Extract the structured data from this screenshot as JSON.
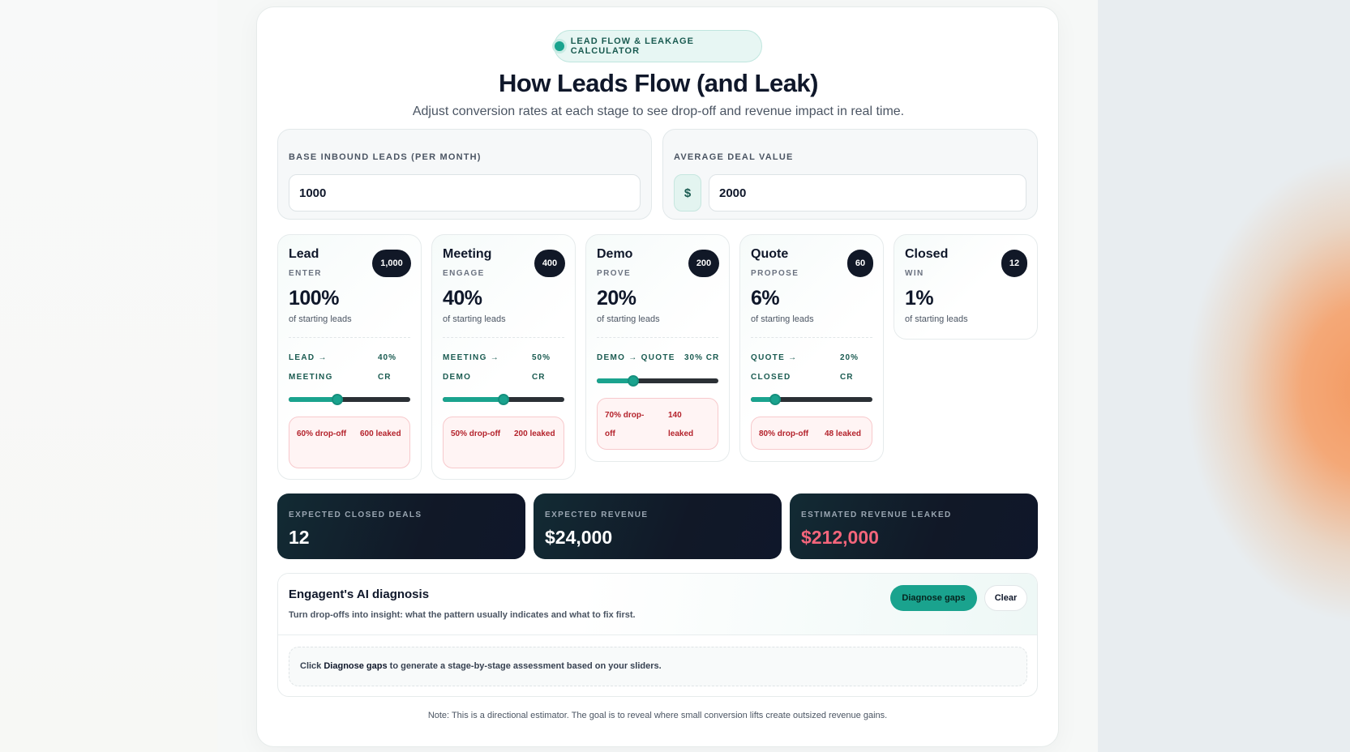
{
  "header": {
    "badge": "LEAD FLOW & LEAKAGE CALCULATOR",
    "title": "How Leads Flow (and Leak)",
    "subtitle": "Adjust conversion rates at each stage to see drop-off and revenue impact in real time."
  },
  "inputs": {
    "base_leads_label": "BASE INBOUND LEADS (PER MONTH)",
    "base_leads_value": "1000",
    "deal_value_label": "AVERAGE DEAL VALUE",
    "currency_symbol": "$",
    "deal_value": "2000"
  },
  "common": {
    "of_starting": "of starting leads"
  },
  "stages": [
    {
      "name": "Lead",
      "verb": "ENTER",
      "count": "1,000",
      "pct": "100%",
      "conv_label": "LEAD → MEETING",
      "cr": "40% CR",
      "cr_value": 40,
      "dropoff": "60% drop-off",
      "leaked": "600 leaked"
    },
    {
      "name": "Meeting",
      "verb": "ENGAGE",
      "count": "400",
      "pct": "40%",
      "conv_label": "MEETING → DEMO",
      "cr": "50% CR",
      "cr_value": 50,
      "dropoff": "50% drop-off",
      "leaked": "200 leaked"
    },
    {
      "name": "Demo",
      "verb": "PROVE",
      "count": "200",
      "pct": "20%",
      "conv_label": "DEMO → QUOTE",
      "cr": "30% CR",
      "cr_value": 30,
      "dropoff": "70% drop-off",
      "leaked": "140 leaked"
    },
    {
      "name": "Quote",
      "verb": "PROPOSE",
      "count": "60",
      "pct": "6%",
      "conv_label": "QUOTE → CLOSED",
      "cr": "20% CR",
      "cr_value": 20,
      "dropoff": "80% drop-off",
      "leaked": "48 leaked"
    },
    {
      "name": "Closed",
      "verb": "WIN",
      "count": "12",
      "pct": "1%"
    }
  ],
  "metrics": [
    {
      "label": "EXPECTED CLOSED DEALS",
      "value": "12",
      "color": "#ffffff"
    },
    {
      "label": "EXPECTED REVENUE",
      "value": "$24,000",
      "color": "#ffffff"
    },
    {
      "label": "ESTIMATED REVENUE LEAKED",
      "value": "$212,000",
      "color": "#f4657b"
    }
  ],
  "diagnosis": {
    "title": "Engagent's AI diagnosis",
    "description": "Turn drop-offs into insight: what the pattern usually indicates and what to fix first.",
    "diagnose_button": "Diagnose gaps",
    "clear_button": "Clear",
    "body_prefix": "Click",
    "body_action": "Diagnose gaps",
    "body_suffix": "to generate a stage-by-stage assessment based on your sliders."
  },
  "note": "Note: This is a directional estimator. The goal is to reveal where small conversion lifts create outsized revenue gains.",
  "colors": {
    "accent": "#1aa38e",
    "leak_red": "#b4232c",
    "dark": "#111827"
  }
}
